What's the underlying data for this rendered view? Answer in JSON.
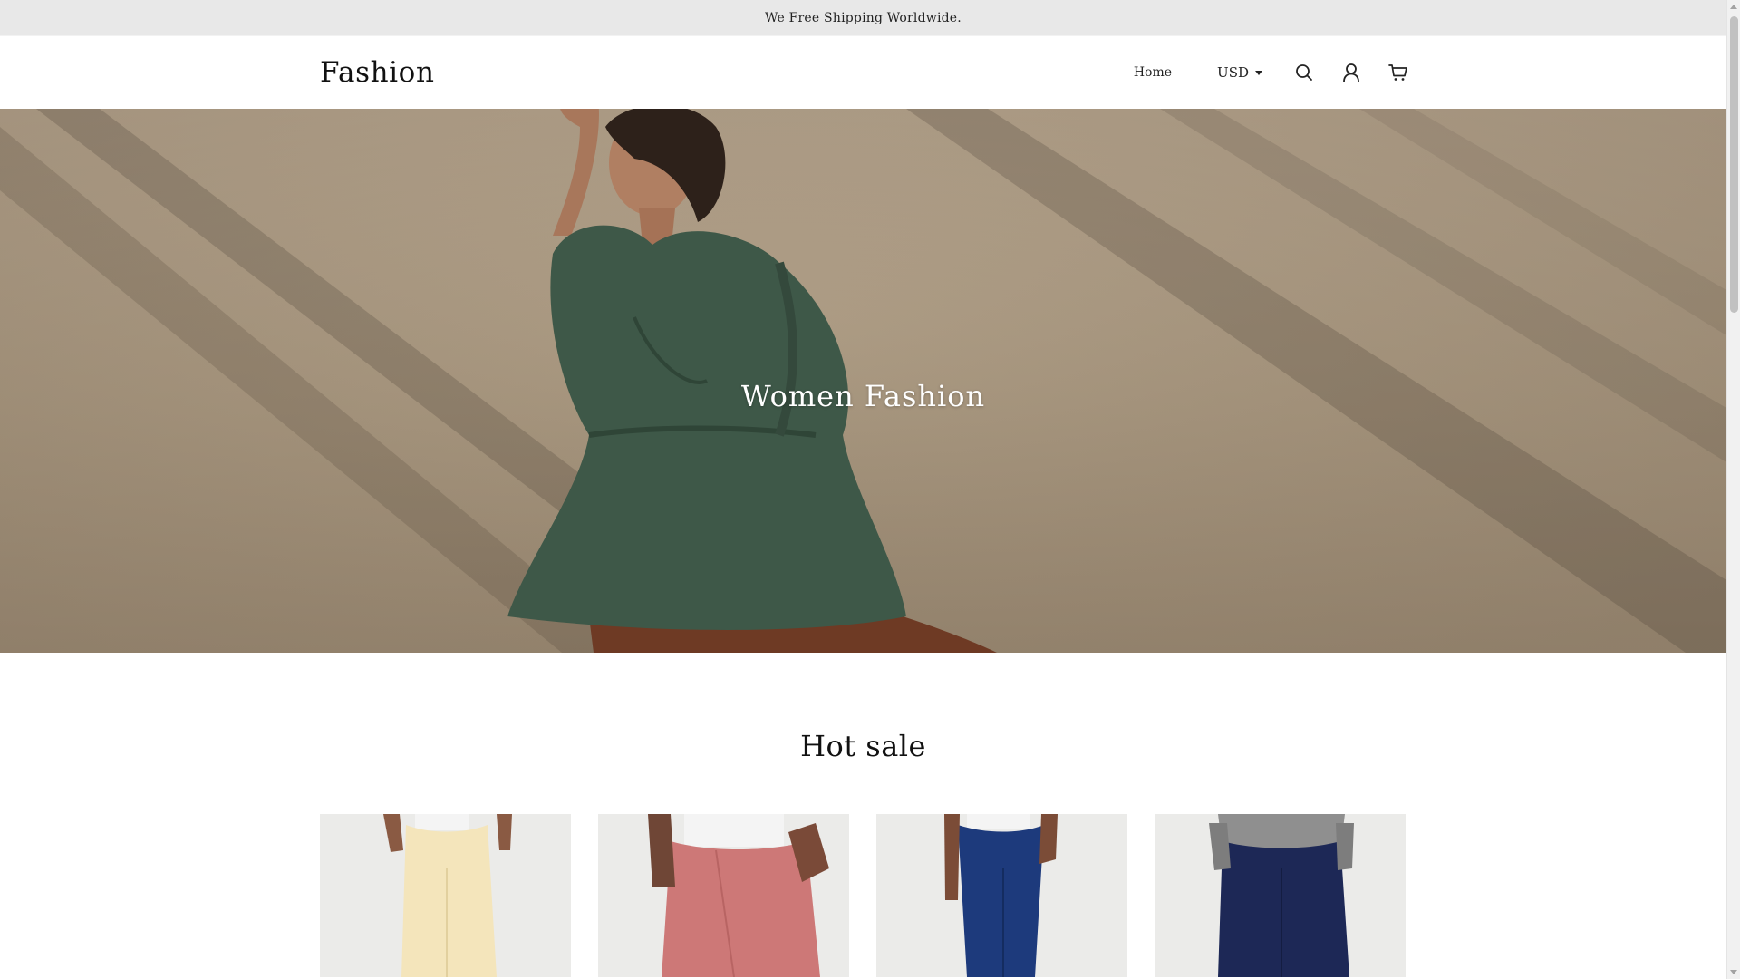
{
  "announcement": {
    "text": "We Free Shipping Worldwide."
  },
  "header": {
    "logo": "Fashion",
    "nav": {
      "home_label": "Home"
    },
    "currency": {
      "selected": "USD"
    },
    "icons": [
      "search-icon",
      "account-icon",
      "cart-icon"
    ]
  },
  "hero": {
    "title": "Women Fashion"
  },
  "hot_sale": {
    "title": "Hot sale",
    "products": [
      {
        "color": "#f4e5bb"
      },
      {
        "color": "#cd7877"
      },
      {
        "color": "#1d3a7c"
      },
      {
        "color": "#1d2856"
      }
    ]
  },
  "colors": {
    "announce_bg": "#e8e8e8",
    "text": "#222222",
    "hero_text": "#ffffff"
  }
}
